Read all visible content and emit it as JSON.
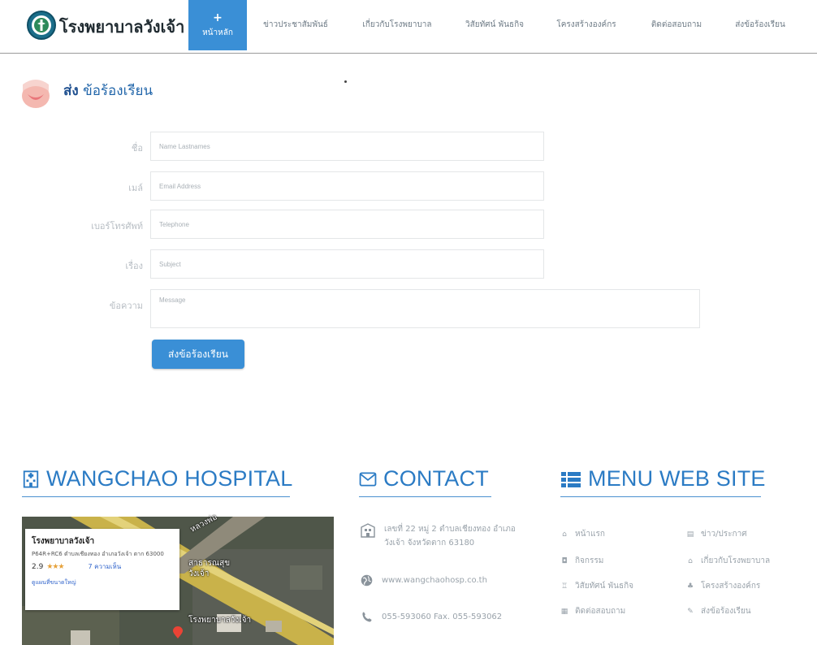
{
  "header": {
    "brand": "โรงพยาบาลวังเจ้า",
    "nav": [
      {
        "label": "หน้าหลัก",
        "icon": "plus-icon"
      },
      {
        "label": "ข่าวประชาสัมพันธ์"
      },
      {
        "label": "เกี่ยวกับโรงพยาบาล"
      },
      {
        "label": "วิสัยทัศน์ พันธกิจ"
      },
      {
        "label": "โครงสร้างองค์กร"
      },
      {
        "label": "ติดต่อสอบถาม"
      },
      {
        "label": "ส่งข้อร้องเรียน"
      }
    ],
    "active_color": "#3a8fd6"
  },
  "page": {
    "title_prefix": "ส่ง",
    "title_rest": "ข้อร้องเรียน"
  },
  "form": {
    "fields": [
      {
        "label": "ชื่อ",
        "placeholder": "Name Lastnames",
        "value": ""
      },
      {
        "label": "เมล์",
        "placeholder": "Email Address",
        "value": ""
      },
      {
        "label": "เบอร์โทรศัพท์",
        "placeholder": "Telephone",
        "value": ""
      },
      {
        "label": "เรื่อง",
        "placeholder": "Subject",
        "value": ""
      },
      {
        "label": "ข้อความ",
        "placeholder": "Message",
        "value": ""
      }
    ],
    "submit_label": "ส่งข้อร้องเรียน"
  },
  "footer": {
    "hospital": {
      "heading": "WANGCHAO HOSPITAL",
      "map_card": {
        "name": "โรงพยาบาลวังเจ้า",
        "address": "P64R+RC6 ตำบลเชียงทอง อำเภอวังเจ้า ตาก 63000",
        "rating": "2.9",
        "stars": "★★★",
        "reviews": "7 ความเห็น",
        "link": "ดูแผนที่ขนาดใหญ่"
      },
      "map_labels": [
        "สาธารณสุข",
        "วังเจ้า",
        "โรงพยาบาลวังเจ้า",
        "หลวงพ่อ"
      ]
    },
    "contact": {
      "heading": "CONTACT",
      "address_line1": "เลขที่ 22 หมู่ 2 ตำบลเชียงทอง อำเภอ",
      "address_line2": "วังเจ้า จังหวัดตาก 63180",
      "website": "www.wangchaohosp.co.th",
      "phone": "055-593060 Fax. 055-593062"
    },
    "menu": {
      "heading": "MENU WEB SITE",
      "links": [
        {
          "label": "หน้าแรก",
          "icon": "home-icon",
          "glyph": "⌂"
        },
        {
          "label": "ข่าว/ประกาศ",
          "icon": "news-icon",
          "glyph": "▤"
        },
        {
          "label": "กิจกรรม",
          "icon": "camera-icon",
          "glyph": "◘"
        },
        {
          "label": "เกี่ยวกับโรงพยาบาล",
          "icon": "hospital-icon",
          "glyph": "⌂"
        },
        {
          "label": "วิสัยทัศน์ พันธกิจ",
          "icon": "trophy-icon",
          "glyph": "♖"
        },
        {
          "label": "โครงสร้างองค์กร",
          "icon": "sitemap-icon",
          "glyph": "♣"
        },
        {
          "label": "ติดต่อสอบถาม",
          "icon": "contact-card-icon",
          "glyph": "▦"
        },
        {
          "label": "ส่งข้อร้องเรียน",
          "icon": "edit-icon",
          "glyph": "✎"
        }
      ]
    }
  }
}
